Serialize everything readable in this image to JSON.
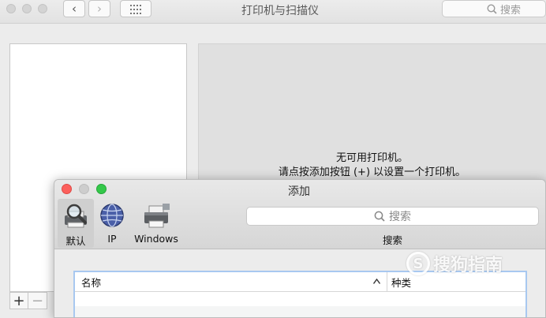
{
  "window": {
    "title": "打印机与扫描仪",
    "back_glyph": "‹",
    "forward_glyph": "›",
    "search_placeholder": "搜索",
    "empty_line1": "无可用打印机。",
    "empty_line2": "请点按添加按钮 (+) 以设置一个打印机。",
    "add_glyph": "+",
    "remove_glyph": "−"
  },
  "dialog": {
    "title": "添加",
    "toolbar": [
      {
        "label": "默认",
        "icon": "default-printer-icon",
        "selected": true
      },
      {
        "label": "IP",
        "icon": "ip-globe-icon",
        "selected": false
      },
      {
        "label": "Windows",
        "icon": "windows-printer-icon",
        "selected": false
      }
    ],
    "search_placeholder": "搜索",
    "search_label": "搜索",
    "table": {
      "columns": [
        "名称",
        "种类"
      ]
    }
  },
  "watermark": {
    "logo_glyph": "S",
    "text": "搜狗指南"
  },
  "colors": {
    "close": "#fc605c",
    "minimize": "#c9c9c9",
    "zoom": "#34c84a",
    "table_focus": "#a8c8f0"
  }
}
